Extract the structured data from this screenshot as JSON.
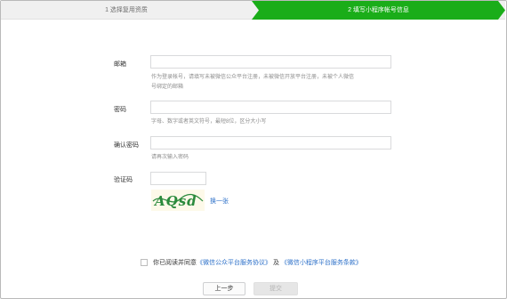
{
  "steps": [
    {
      "label": "1 选择复用资质",
      "state": "done"
    },
    {
      "label": "2 填写小程序帐号信息",
      "state": "active"
    }
  ],
  "colors": {
    "active_step": "#1aad19",
    "link": "#2e71c9"
  },
  "form": {
    "email": {
      "label": "邮箱",
      "value": "",
      "hint_line1": "作为登录帐号，请填写未被微信公众平台注册，未被微信开放平台注册，未被个人微信",
      "hint_line2": "号绑定的邮箱"
    },
    "password": {
      "label": "密码",
      "value": "",
      "hint": "字母、数字或者英文符号，最短8位，区分大小写"
    },
    "confirm_password": {
      "label": "确认密码",
      "value": "",
      "hint": "请再次输入密码"
    },
    "captcha": {
      "label": "验证码",
      "value": "",
      "image_text": "AQsd",
      "refresh_label": "换一张"
    }
  },
  "agreement": {
    "checked": false,
    "prefix": "你已阅读并同意",
    "link1": "《微信公众平台服务协议》",
    "joiner": "及",
    "link2": "《微信小程序平台服务条款》"
  },
  "buttons": {
    "prev": "上一步",
    "submit": "提交"
  }
}
